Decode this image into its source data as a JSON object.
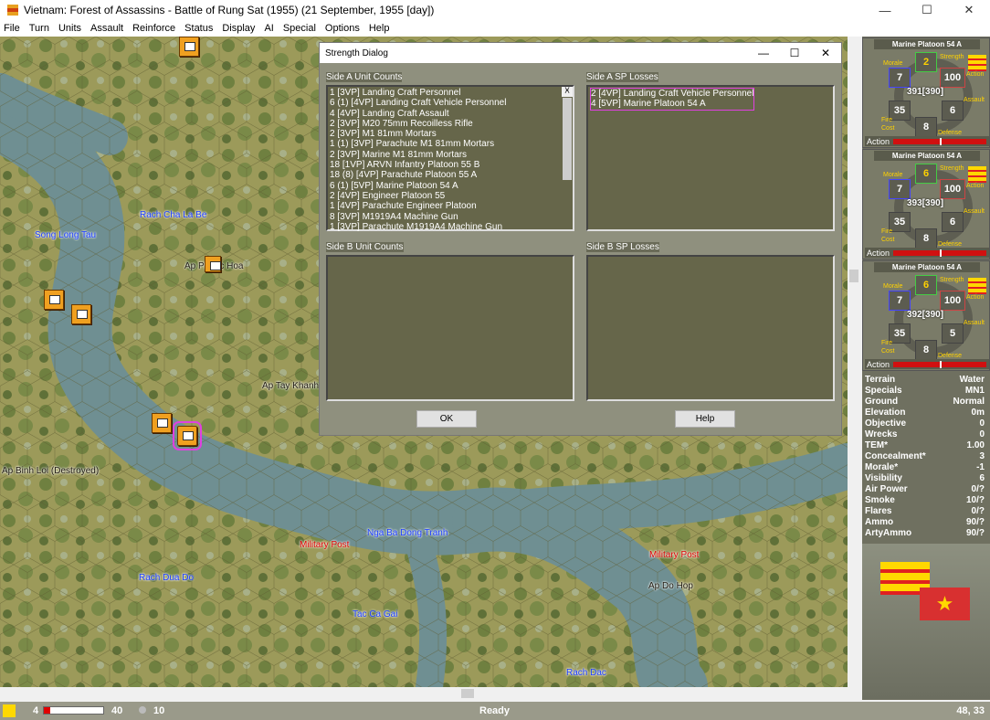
{
  "window": {
    "title": "Vietnam: Forest of Assassins - Battle of Rung Sat (1955) (21 September, 1955 [day])",
    "min": "—",
    "max": "☐",
    "close": "✕"
  },
  "menu": [
    "File",
    "Turn",
    "Units",
    "Assault",
    "Reinforce",
    "Status",
    "Display",
    "AI",
    "Special",
    "Options",
    "Help"
  ],
  "map": {
    "labels": [
      {
        "t": "Song Long Tau",
        "c": ""
      },
      {
        "t": "Rach Cha La Be",
        "c": ""
      },
      {
        "t": "Ap Phuoc Hoa",
        "c": "dark"
      },
      {
        "t": "Ap Tay Khanh",
        "c": "dark"
      },
      {
        "t": "Ap Binh Loi (Destroyed)",
        "c": "dark"
      },
      {
        "t": "Nga Ba Dong Tranh",
        "c": ""
      },
      {
        "t": "Military Post",
        "c": "red"
      },
      {
        "t": "Military Post",
        "c": "red"
      },
      {
        "t": "Rach Dua Do",
        "c": ""
      },
      {
        "t": "Tac Ca Gai",
        "c": ""
      },
      {
        "t": "Ap Do Hop",
        "c": "dark"
      },
      {
        "t": "Rach Dac",
        "c": ""
      }
    ]
  },
  "dialog": {
    "title": "Strength Dialog",
    "side_a_counts_label": "Side A Unit Counts",
    "side_a_losses_label": "Side A SP Losses",
    "side_b_counts_label": "Side B Unit Counts",
    "side_b_losses_label": "Side B SP Losses",
    "side_a_counts": [
      "1 [3VP] Landing Craft Personnel",
      "6 (1) [4VP] Landing Craft Vehicle Personnel",
      "4 [4VP] Landing Craft Assault",
      "2 [3VP] M20 75mm Recoilless Rifle",
      "2 [3VP] M1 81mm Mortars",
      "1 (1) [3VP] Parachute M1 81mm Mortars",
      "2 [3VP] Marine M1 81mm Mortars",
      "18 [1VP] ARVN Infantry Platoon 55 B",
      "18 (8) [4VP] Parachute Platoon 55 A",
      "6 (1) [5VP] Marine Platoon 54 A",
      "2 [4VP] Engineer Platoon 55",
      "1 [4VP] Parachute Engineer Platoon",
      "8 [3VP] M1919A4 Machine Gun",
      "1 [3VP] Parachute M1919A4 Machine Gun"
    ],
    "side_a_losses": [
      "2 [4VP] Landing Craft Vehicle Personnel",
      "4 [5VP] Marine Platoon 54 A"
    ],
    "ok": "OK",
    "help": "Help",
    "scroll_up": "˄",
    "scroll_down": "˅"
  },
  "cards": [
    {
      "name": "Marine Platoon 54 A",
      "strength": "2",
      "morale": "7",
      "action": "100",
      "fire_cost": "35",
      "defense": "8",
      "assault": "6",
      "points": "391[390]"
    },
    {
      "name": "Marine Platoon 54 A",
      "strength": "6",
      "morale": "7",
      "action": "100",
      "fire_cost": "35",
      "defense": "8",
      "assault": "6",
      "points": "393[390]"
    },
    {
      "name": "Marine Platoon 54 A",
      "strength": "6",
      "morale": "7",
      "action": "100",
      "fire_cost": "35",
      "defense": "8",
      "assault": "5",
      "points": "392[390]"
    }
  ],
  "card_labels": {
    "strength": "Strength",
    "morale": "Morale",
    "action": "Action",
    "fire": "Fire",
    "cost": "Cost",
    "defense": "Defense",
    "assault": "Assault",
    "action_bar": "Action"
  },
  "stats": [
    [
      "Terrain",
      "Water"
    ],
    [
      "Specials",
      "MN1"
    ],
    [
      "Ground",
      "Normal"
    ],
    [
      "Elevation",
      "0m"
    ],
    [
      "Objective",
      "0"
    ],
    [
      "Wrecks",
      "0"
    ],
    [
      "TEM*",
      "1.00"
    ],
    [
      "Concealment*",
      "3"
    ],
    [
      "Morale*",
      "-1"
    ],
    [
      "Visibility",
      "6"
    ],
    [
      "Air Power",
      "0/?"
    ],
    [
      "Smoke",
      "10/?"
    ],
    [
      "Flares",
      "0/?"
    ],
    [
      "Ammo",
      "90/?"
    ],
    [
      "ArtyAmmo",
      "90/?"
    ]
  ],
  "status": {
    "turn": "4",
    "max_turn": "40",
    "turn_progress": 0.1,
    "weather_value": "10",
    "message": "Ready",
    "coords": "48, 33"
  },
  "colors": {
    "water": "#6f8f92",
    "terrain": "#9c9a5a",
    "dialog": "#8f907e",
    "list": "#66664a",
    "flag_yellow": "#ffd800",
    "flag_red": "#e02020"
  }
}
